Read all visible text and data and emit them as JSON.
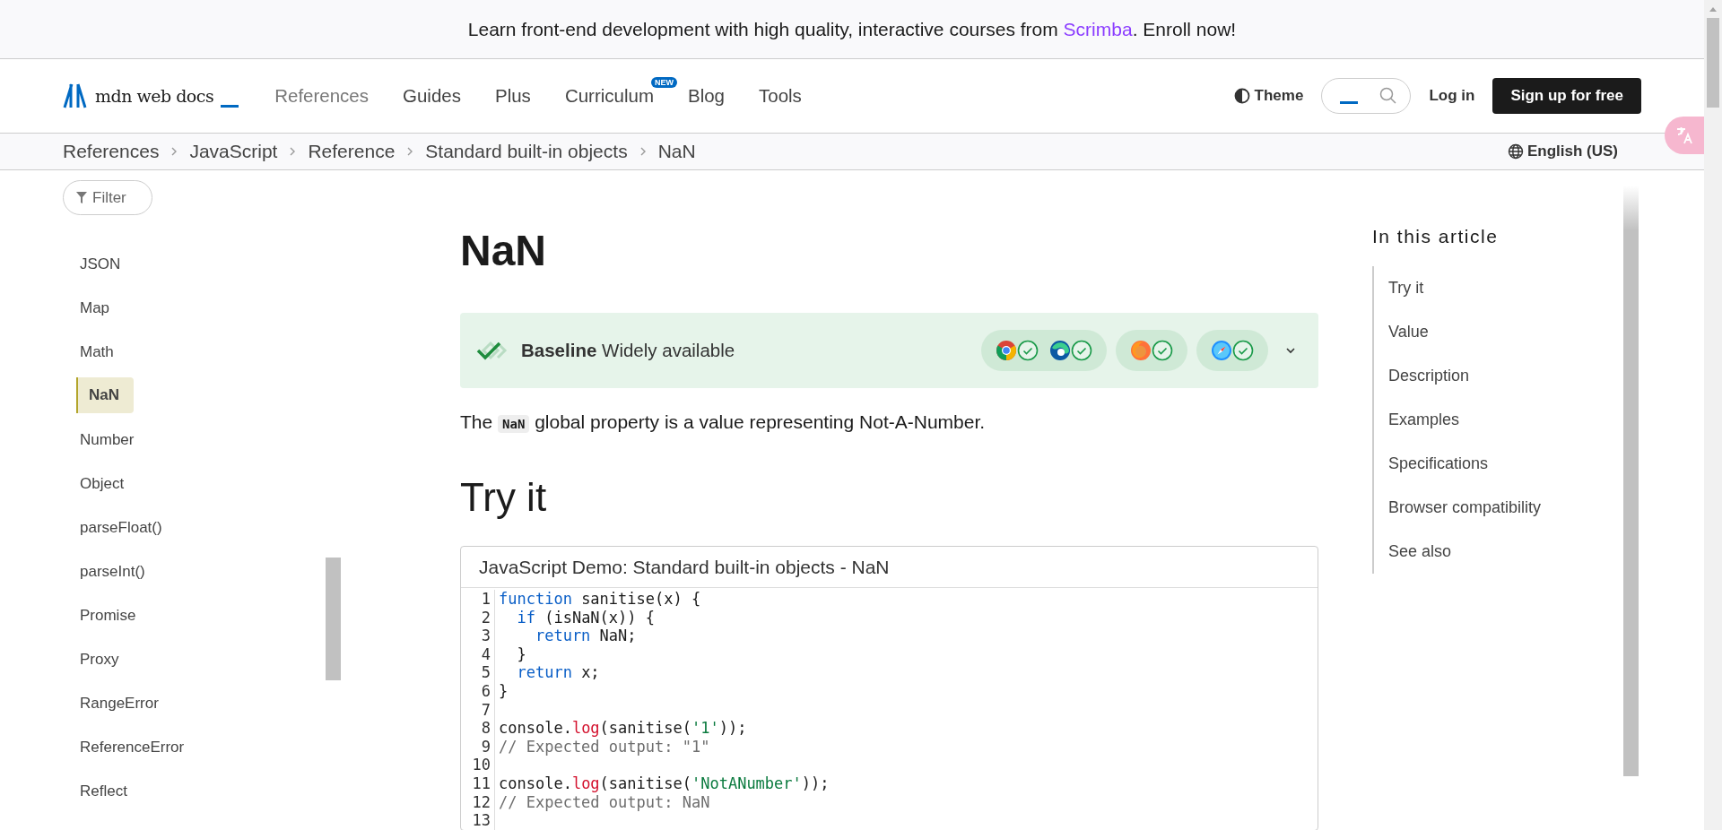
{
  "banner": {
    "before": "Learn front-end development with high quality, interactive courses from ",
    "link": "Scrimba",
    "after": ". Enroll now!"
  },
  "header": {
    "logo": "mdn web docs",
    "nav": [
      {
        "label": "References",
        "selected": true
      },
      {
        "label": "Guides",
        "selected": false
      },
      {
        "label": "Plus",
        "selected": false
      },
      {
        "label": "Curriculum",
        "selected": false,
        "badge": "NEW"
      },
      {
        "label": "Blog",
        "selected": false
      },
      {
        "label": "Tools",
        "selected": false
      }
    ],
    "theme": "Theme",
    "login": "Log in",
    "signup": "Sign up for free"
  },
  "breadcrumbs": [
    "References",
    "JavaScript",
    "Reference",
    "Standard built-in objects",
    "NaN"
  ],
  "language": "English (US)",
  "sidebar": {
    "filter": "Filter",
    "items": [
      {
        "label": "JSON",
        "selected": false
      },
      {
        "label": "Map",
        "selected": false
      },
      {
        "label": "Math",
        "selected": false
      },
      {
        "label": "NaN",
        "selected": true
      },
      {
        "label": "Number",
        "selected": false
      },
      {
        "label": "Object",
        "selected": false
      },
      {
        "label": "parseFloat()",
        "selected": false
      },
      {
        "label": "parseInt()",
        "selected": false
      },
      {
        "label": "Promise",
        "selected": false
      },
      {
        "label": "Proxy",
        "selected": false
      },
      {
        "label": "RangeError",
        "selected": false
      },
      {
        "label": "ReferenceError",
        "selected": false
      },
      {
        "label": "Reflect",
        "selected": false
      }
    ]
  },
  "article": {
    "title": "NaN",
    "baseline": {
      "label": "Baseline",
      "status": "Widely available",
      "groups": [
        [
          {
            "kind": "chrome",
            "supported": true
          },
          {
            "kind": "edge",
            "supported": true
          }
        ],
        [
          {
            "kind": "firefox",
            "supported": true
          }
        ],
        [
          {
            "kind": "safari",
            "supported": true
          }
        ]
      ]
    },
    "intro": {
      "before": "The ",
      "code": "NaN",
      "after": " global property is a value representing Not-A-Number."
    },
    "section": "Try it",
    "demo": {
      "title": "JavaScript Demo: Standard built-in objects - NaN",
      "lines": [
        {
          "number": "1",
          "tokens": [
            {
              "text": "function",
              "kind": "keyword"
            },
            {
              "text": " sanitise(x) {",
              "kind": "plain"
            }
          ]
        },
        {
          "number": "2",
          "tokens": [
            {
              "text": "  if",
              "kind": "keyword"
            },
            {
              "text": " (isNaN(x)) {",
              "kind": "plain"
            }
          ]
        },
        {
          "number": "3",
          "tokens": [
            {
              "text": "    return",
              "kind": "keyword"
            },
            {
              "text": " NaN;",
              "kind": "plain"
            }
          ]
        },
        {
          "number": "4",
          "tokens": [
            {
              "text": "  }",
              "kind": "plain"
            }
          ]
        },
        {
          "number": "5",
          "tokens": [
            {
              "text": "  return",
              "kind": "keyword"
            },
            {
              "text": " x;",
              "kind": "plain"
            }
          ]
        },
        {
          "number": "6",
          "tokens": [
            {
              "text": "}",
              "kind": "plain"
            }
          ]
        },
        {
          "number": "7"
        },
        {
          "number": "8",
          "tokens": [
            {
              "text": "console.",
              "kind": "plain"
            },
            {
              "text": "log",
              "kind": "method"
            },
            {
              "text": "(sanitise(",
              "kind": "plain"
            },
            {
              "text": "'1'",
              "kind": "string"
            },
            {
              "text": "));",
              "kind": "plain"
            }
          ]
        },
        {
          "number": "9",
          "tokens": [
            {
              "text": "// Expected output: \"1\"",
              "kind": "comment"
            }
          ]
        },
        {
          "number": "10"
        },
        {
          "number": "11",
          "tokens": [
            {
              "text": "console.",
              "kind": "plain"
            },
            {
              "text": "log",
              "kind": "method"
            },
            {
              "text": "(sanitise(",
              "kind": "plain"
            },
            {
              "text": "'NotANumber'",
              "kind": "string"
            },
            {
              "text": "));",
              "kind": "plain"
            }
          ]
        },
        {
          "number": "12",
          "tokens": [
            {
              "text": "// Expected output: NaN",
              "kind": "comment"
            }
          ]
        },
        {
          "number": "13"
        }
      ]
    }
  },
  "toc": {
    "title": "In this article",
    "items": [
      "Try it",
      "Value",
      "Description",
      "Examples",
      "Specifications",
      "Browser compatibility",
      "See also"
    ]
  }
}
